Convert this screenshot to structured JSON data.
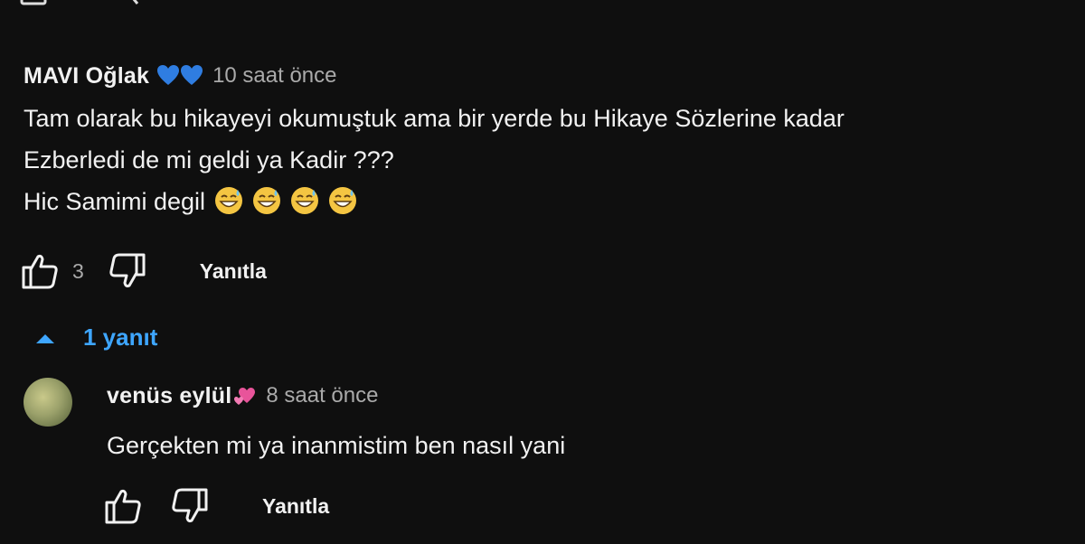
{
  "comment": {
    "author": "MAVI Oğlak",
    "author_emoji": "blue-hearts-icon",
    "time": "10 saat önce",
    "lines": [
      "Tam olarak bu hikayeyi okumuştuk ama bir yerde bu Hikaye Sözlerine kadar",
      "Ezberledi de mi geldi ya Kadir ???",
      "Hic Samimi degil"
    ],
    "trailing_emoji": "grinning-sweat-emoji x4",
    "like_count": "3",
    "reply_label": "Yanıtla"
  },
  "replies_toggle": {
    "label": "1 yanıt",
    "expanded": true
  },
  "reply": {
    "author": "venüs eylül",
    "author_emoji": "two-hearts-icon",
    "time": "8 saat önce",
    "text": "Gerçekten mi ya inanmistim ben nasıl yani",
    "reply_label": "Yanıtla"
  },
  "colors": {
    "background": "#0f0f0f",
    "text": "#f1f1f1",
    "muted": "#aaaaaa",
    "link": "#3ea6ff",
    "heart": "#2f7de1"
  }
}
